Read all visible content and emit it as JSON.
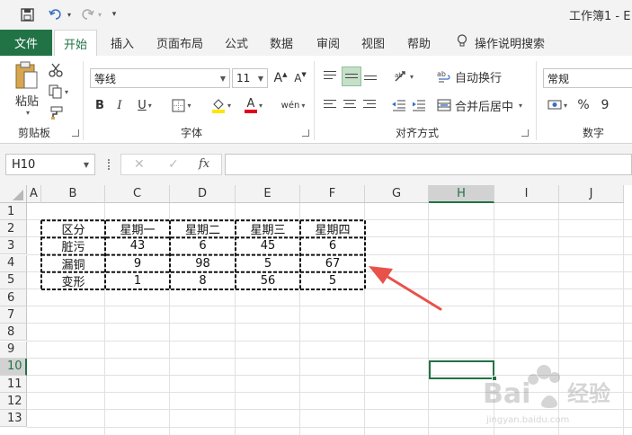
{
  "titlebar": {
    "doc_title": "工作簿1  -  E"
  },
  "ribbon_tabs": [
    {
      "label": "文件"
    },
    {
      "label": "开始"
    },
    {
      "label": "插入"
    },
    {
      "label": "页面布局"
    },
    {
      "label": "公式"
    },
    {
      "label": "数据"
    },
    {
      "label": "审阅"
    },
    {
      "label": "视图"
    },
    {
      "label": "帮助"
    },
    {
      "label": "操作说明搜索"
    }
  ],
  "clipboard": {
    "paste_label": "粘贴",
    "group_label": "剪贴板"
  },
  "font": {
    "font_name": "等线",
    "font_size": "11",
    "bold": "B",
    "italic": "I",
    "underline": "U",
    "grow": "A",
    "shrink": "A",
    "font_color_glyph": "A",
    "phonetic": "wén",
    "group_label": "字体"
  },
  "alignment": {
    "wrap_text": "自动换行",
    "merge_center": "合并后居中",
    "group_label": "对齐方式"
  },
  "number": {
    "format": "常规",
    "percent": "%",
    "comma": "9",
    "group_label": "数字"
  },
  "formula_bar": {
    "cell_ref": "H10",
    "fx": "fx",
    "cancel": "✕",
    "enter": "✓"
  },
  "columns": [
    "A",
    "B",
    "C",
    "D",
    "E",
    "F",
    "G",
    "H",
    "I",
    "J"
  ],
  "rows": [
    "1",
    "2",
    "3",
    "4",
    "5",
    "6",
    "7",
    "8",
    "9",
    "10",
    "11",
    "12",
    "13"
  ],
  "table": {
    "headers": [
      "区分",
      "星期一",
      "星期二",
      "星期三",
      "星期四"
    ],
    "rows": [
      [
        "脏污",
        "43",
        "6",
        "45",
        "6"
      ],
      [
        "漏铜",
        "9",
        "98",
        "5",
        "67"
      ],
      [
        "变形",
        "1",
        "8",
        "56",
        "5"
      ]
    ]
  },
  "selected_cell": "H10",
  "colors": {
    "brand": "#217346",
    "arrow": "#e8524a"
  }
}
